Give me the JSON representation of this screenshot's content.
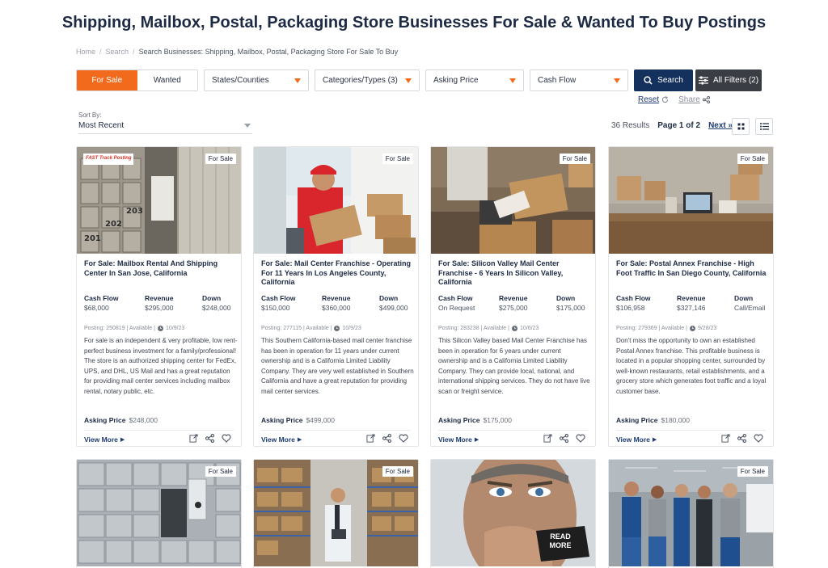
{
  "page": {
    "title": "Shipping, Mailbox, Postal, Packaging Store Businesses For Sale & Wanted To Buy Postings"
  },
  "breadcrumb": {
    "home": "Home",
    "search": "Search",
    "current": "Search Businesses: Shipping, Mailbox, Postal, Packaging Store For Sale To Buy"
  },
  "filters": {
    "for_sale": "For Sale",
    "wanted": "Wanted",
    "states": "States/Counties",
    "categories": "Categories/Types (3)",
    "asking_price": "Asking Price",
    "cash_flow": "Cash Flow",
    "search": "Search",
    "all_filters": "All Filters (2)",
    "reset": "Reset",
    "share": "Share"
  },
  "sort": {
    "label": "Sort By:",
    "value": "Most Recent"
  },
  "results": {
    "count": "36 Results",
    "page": "Page 1 of 2",
    "next": "Next"
  },
  "colors": {
    "accent": "#f26b1d",
    "navy": "#13315c",
    "dark_button": "#3a3d43"
  },
  "listings": [
    {
      "badge": "For Sale",
      "logo": "FAST Track Posting",
      "title": "For Sale: Mailbox Rental And Shipping Center In San Jose, California",
      "cash_flow_label": "Cash Flow",
      "cash_flow": "$68,000",
      "revenue_label": "Revenue",
      "revenue": "$295,000",
      "down_label": "Down",
      "down": "$248,000",
      "posting": "Posting: 250819 | Available |",
      "date": "10/9/23",
      "description": "For sale is an independent & very profitable, low rent-perfect business investment for a family/professional! The store is an authorized shipping center for FedEx, UPS, and DHL, US Mail and has a great reputation for providing mail center services including mailbox rental, notary public, etc.",
      "asking_label": "Asking Price",
      "asking": "$248,000",
      "view_more": "View More",
      "photo": "mailboxes"
    },
    {
      "badge": "For Sale",
      "title": "For Sale: Mail Center Franchise - Operating For 11 Years In Los Angeles County, California",
      "cash_flow_label": "Cash Flow",
      "cash_flow": "$150,000",
      "revenue_label": "Revenue",
      "revenue": "$360,000",
      "down_label": "Down",
      "down": "$499,000",
      "posting": "Posting: 277115 | Available |",
      "date": "10/9/23",
      "description": "This Southern California-based mail center franchise has been in operation for 11 years under current ownership and is a California Limited Liability Company. They are very well established in Southern California and have a great reputation for providing mail center services.",
      "asking_label": "Asking Price",
      "asking": "$499,000",
      "view_more": "View More",
      "photo": "delivery"
    },
    {
      "badge": "For Sale",
      "title": "For Sale: Silicon Valley Mail Center Franchise - 6 Years In Silicon Valley, California",
      "cash_flow_label": "Cash Flow",
      "cash_flow": "On Request",
      "revenue_label": "Revenue",
      "revenue": "$275,000",
      "down_label": "Down",
      "down": "$175,000",
      "posting": "Posting: 283238 | Available |",
      "date": "10/6/23",
      "description": "This Silicon Valley based Mail Center Franchise has been in operation for 6 years under current ownership and is a California Limited Liability Company. They can provide local, national, and international shipping services. They do not have live scan or freight service.",
      "asking_label": "Asking Price",
      "asking": "$175,000",
      "view_more": "View More",
      "photo": "packing"
    },
    {
      "badge": "For Sale",
      "title": "For Sale: Postal Annex Franchise - High Foot Traffic In San Diego County, California",
      "cash_flow_label": "Cash Flow",
      "cash_flow": "$106,958",
      "revenue_label": "Revenue",
      "revenue": "$327,146",
      "down_label": "Down",
      "down": "Call/Email",
      "posting": "Posting: 279369 | Available |",
      "date": "9/28/23",
      "description": "Don't miss the opportunity to own an established Postal Annex franchise. This profitable business is located in a popular shopping center, surrounded by well-known restaurants, retail establishments, and a grocery store which generates foot traffic and a loyal customer base.",
      "asking_label": "Asking Price",
      "asking": "$180,000",
      "view_more": "View More",
      "photo": "office"
    }
  ],
  "row2": [
    {
      "badge": "For Sale",
      "photo": "lockers"
    },
    {
      "badge": "For Sale",
      "photo": "warehouse"
    },
    {
      "badge": "",
      "photo": "read-more",
      "overlay": "READ MORE"
    },
    {
      "badge": "For Sale",
      "photo": "team"
    }
  ]
}
